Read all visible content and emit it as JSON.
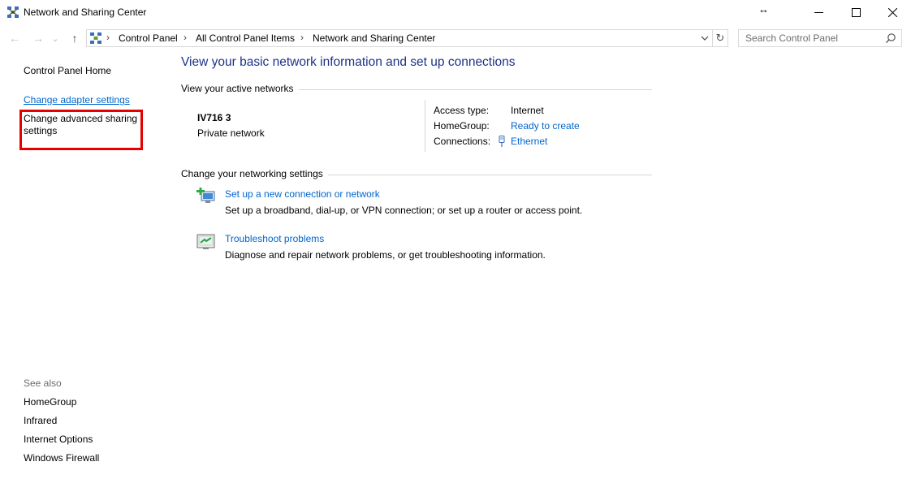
{
  "window": {
    "title": "Network and Sharing Center",
    "resize_glyph": "↔",
    "controls": [
      "minimize-icon",
      "maximize-icon",
      "close-icon"
    ]
  },
  "navigation": {
    "back_glyph": "←",
    "forward_glyph": "→",
    "recent_glyph": "⌄",
    "up_glyph": "↑",
    "breadcrumb": [
      "Control Panel",
      "All Control Panel Items",
      "Network and Sharing Center"
    ],
    "separator": "›",
    "refresh_glyph": "↻",
    "search_placeholder": "Search Control Panel"
  },
  "left_pane": {
    "home": "Control Panel Home",
    "adapter_settings": "Change adapter settings",
    "advanced_sharing": "Change advanced sharing settings",
    "see_also_label": "See also",
    "see_also": [
      "HomeGroup",
      "Infrared",
      "Internet Options",
      "Windows Firewall"
    ],
    "highlight_color": "#e60000"
  },
  "main": {
    "title": "View your basic network information and set up connections",
    "active_networks_heading": "View your active networks",
    "network": {
      "name": "IV716  3",
      "category": "Private network",
      "access_type_label": "Access type:",
      "access_type_value": "Internet",
      "homegroup_label": "HomeGroup:",
      "homegroup_value": "Ready to create",
      "connections_label": "Connections:",
      "connections_value": "Ethernet"
    },
    "settings_heading": "Change your networking settings",
    "tasks": [
      {
        "link": "Set up a new connection or network",
        "description": "Set up a broadband, dial-up, or VPN connection; or set up a router or access point.",
        "icon": "new-connection-icon"
      },
      {
        "link": "Troubleshoot problems",
        "description": "Diagnose and repair network problems, or get troubleshooting information.",
        "icon": "troubleshoot-icon"
      }
    ]
  },
  "colors": {
    "link": "#0066cc",
    "title": "#1e3287",
    "muted": "#6d6d6d"
  }
}
